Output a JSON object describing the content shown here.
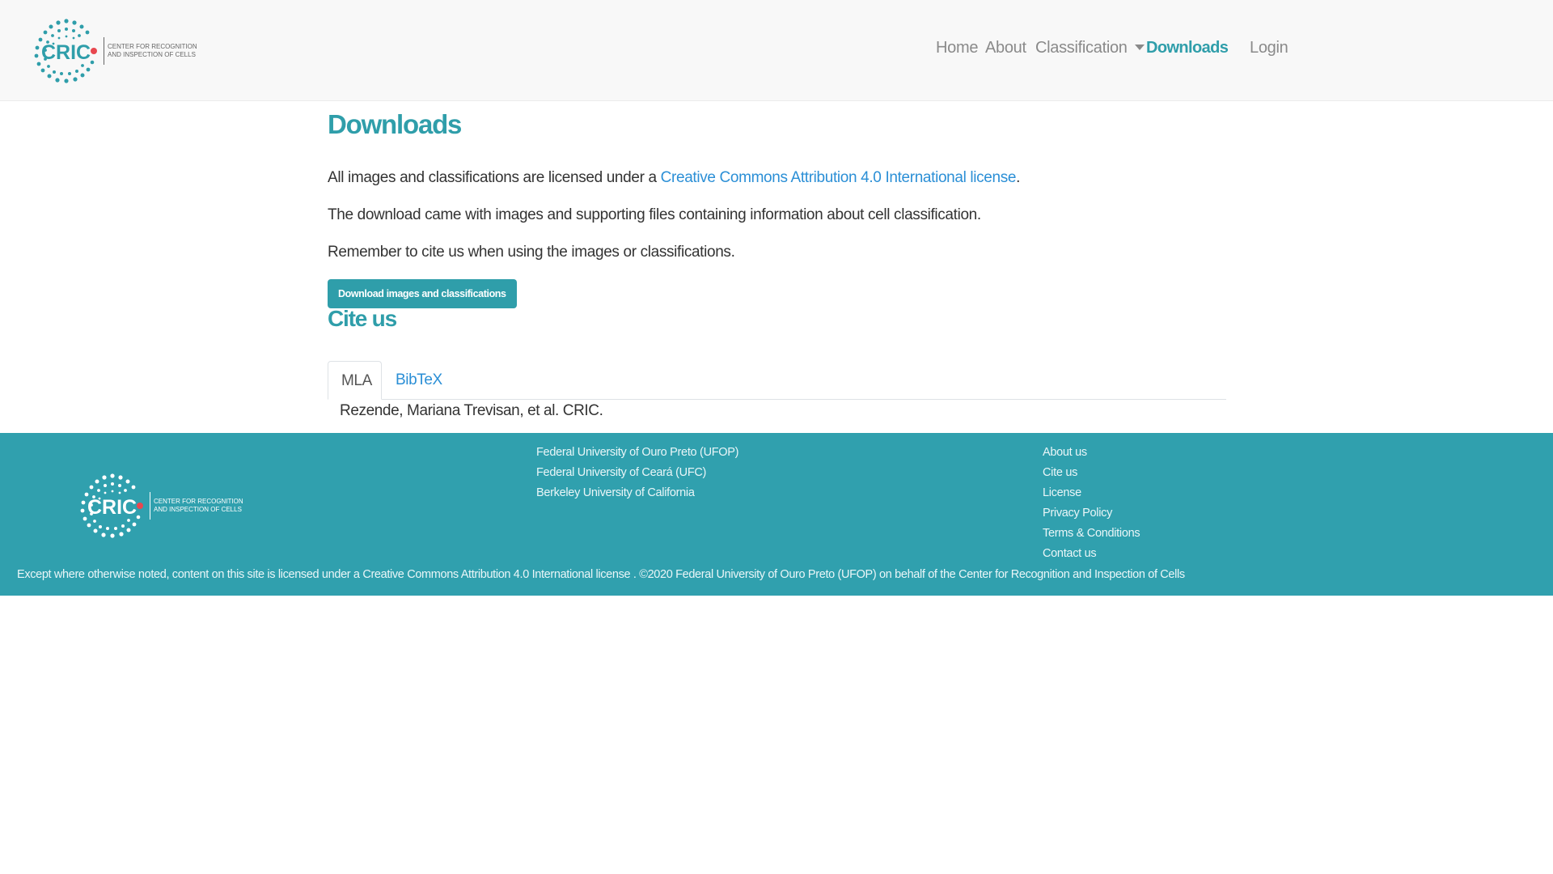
{
  "brand": {
    "logo_text": "CRIC",
    "tagline_line1": "CENTER FOR RECOGNITION",
    "tagline_line2": "AND INSPECTION OF CELLS",
    "colors": {
      "primary": "#2f9eaa",
      "accent_dot": "#e8474f",
      "link": "#2b8fd6"
    }
  },
  "nav": {
    "items": [
      {
        "label": "Home",
        "active": false
      },
      {
        "label": "About",
        "active": false
      },
      {
        "label": "Classification",
        "active": false,
        "dropdown": true
      },
      {
        "label": "Downloads",
        "active": true
      }
    ],
    "login": "Login"
  },
  "main": {
    "title": "Downloads",
    "license_prefix": "All images and classifications are licensed under a ",
    "license_link": "Creative Commons Attribution 4.0 International license",
    "license_suffix": ".",
    "paragraph2": "The download came with images and supporting files containing information about cell classification.",
    "paragraph3": "Remember to cite us when using the images or classifications.",
    "download_button": "Download images and classifications",
    "cite_title": "Cite us",
    "tabs": [
      {
        "label": "MLA",
        "active": true
      },
      {
        "label": "BibTeX",
        "active": false
      }
    ],
    "citation": "Rezende, Mariana Trevisan, et al. CRIC."
  },
  "footer": {
    "universities": [
      "Federal University of Ouro Preto (UFOP)",
      "Federal University of Ceará (UFC)",
      "Berkeley University of California"
    ],
    "links": [
      "About us",
      "Cite us",
      "License",
      "Privacy Policy",
      "Terms & Conditions",
      "Contact us"
    ],
    "copyright": "Except where otherwise noted, content on this site is licensed under a Creative Commons Attribution 4.0 International license . ©2020 Federal University of Ouro Preto (UFOP) on behalf of the Center for Recognition and Inspection of Cells"
  }
}
